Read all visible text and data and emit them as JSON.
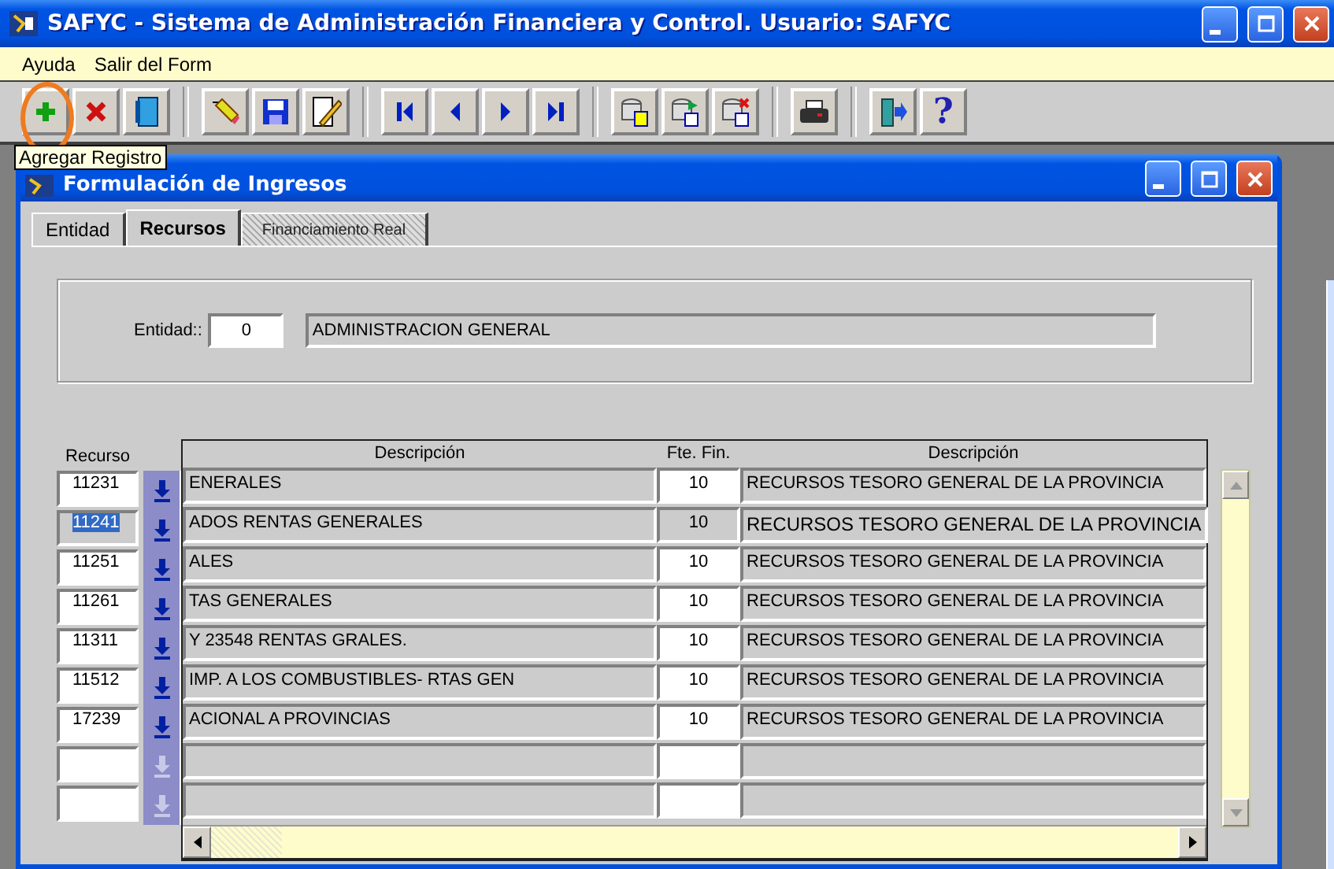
{
  "window": {
    "title": "SAFYC - Sistema de Administración Financiera y Control. Usuario: SAFYC"
  },
  "menu": [
    "Ayuda",
    "Salir del Form"
  ],
  "toolbar": {
    "help_label": "?",
    "highlighted": true,
    "tooltip": "Agregar Registro"
  },
  "form": {
    "title": "Formulación de Ingresos"
  },
  "tabs": [
    {
      "label": "Entidad",
      "selected": false,
      "focused": false
    },
    {
      "label": "Recursos",
      "selected": true,
      "focused": false
    },
    {
      "label": "Financiamiento Real",
      "selected": false,
      "focused": true
    }
  ],
  "entidad": {
    "label": "Entidad::",
    "code": "0",
    "name": "ADMINISTRACION GENERAL"
  },
  "table": {
    "columns": [
      "Recurso",
      "Descripción",
      "Fte. Fin.",
      "Descripción"
    ],
    "rows": [
      {
        "recurso": "11231",
        "descripcion": "ENERALES",
        "fte": "10",
        "fuente": "RECURSOS TESORO GENERAL DE LA PROVINCIA",
        "selected": false,
        "disabled": false
      },
      {
        "recurso": "11241",
        "descripcion": "ADOS RENTAS GENERALES",
        "fte": "10",
        "fuente": "RECURSOS TESORO GENERAL DE LA PROVINCIA",
        "selected": true,
        "disabled": false
      },
      {
        "recurso": "11251",
        "descripcion": "ALES",
        "fte": "10",
        "fuente": "RECURSOS TESORO GENERAL DE LA PROVINCIA",
        "selected": false,
        "disabled": false
      },
      {
        "recurso": "11261",
        "descripcion": "TAS GENERALES",
        "fte": "10",
        "fuente": "RECURSOS TESORO GENERAL DE LA PROVINCIA",
        "selected": false,
        "disabled": false
      },
      {
        "recurso": "11311",
        "descripcion": "Y 23548 RENTAS GRALES.",
        "fte": "10",
        "fuente": "RECURSOS TESORO GENERAL DE LA PROVINCIA",
        "selected": false,
        "disabled": false
      },
      {
        "recurso": "11512",
        "descripcion": "IMP. A LOS COMBUSTIBLES- RTAS GEN",
        "fte": "10",
        "fuente": "RECURSOS TESORO GENERAL DE LA PROVINCIA",
        "selected": false,
        "disabled": false
      },
      {
        "recurso": "17239",
        "descripcion": "ACIONAL A PROVINCIAS",
        "fte": "10",
        "fuente": "RECURSOS TESORO GENERAL DE LA PROVINCIA",
        "selected": false,
        "disabled": false
      },
      {
        "selected": false,
        "disabled": true
      },
      {
        "selected": false,
        "disabled": true
      }
    ]
  }
}
